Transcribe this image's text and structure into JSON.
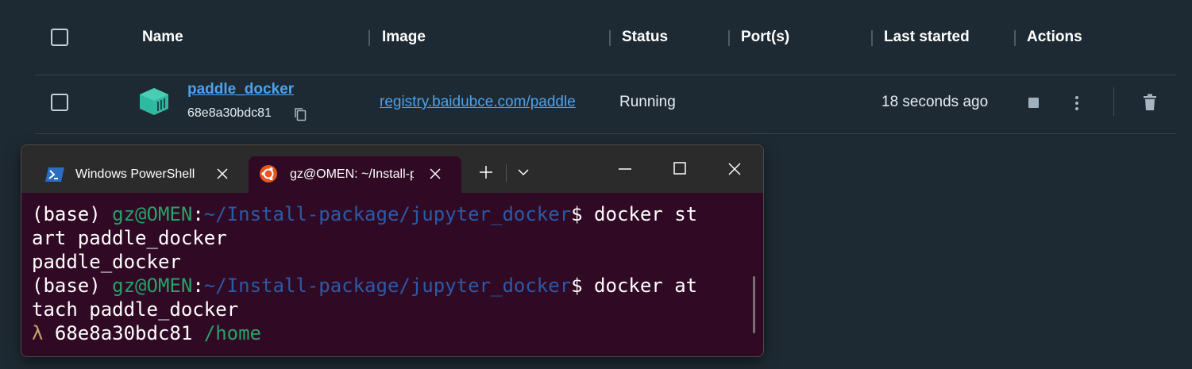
{
  "table": {
    "headers": {
      "name": "Name",
      "image": "Image",
      "status": "Status",
      "ports": "Port(s)",
      "last_started": "Last started",
      "actions": "Actions"
    },
    "rows": [
      {
        "name": "paddle_docker",
        "id": "68e8a30bdc81",
        "image": "registry.baidubce.com/paddle",
        "status": "Running",
        "ports": "",
        "last_started": "18 seconds ago"
      }
    ]
  },
  "terminal": {
    "tabs": [
      {
        "label": "Windows PowerShell",
        "icon": "powershell-icon",
        "active": false
      },
      {
        "label": "gz@OMEN: ~/Install-package/jupyter_docker",
        "icon": "ubuntu-icon",
        "active": true
      }
    ],
    "lines": [
      {
        "prompt_base": "(base) ",
        "prompt_user": "gz@OMEN",
        "prompt_colon": ":",
        "prompt_path": "~/Install-package/jupyter_docker",
        "prompt_dollar": "$",
        "command": " docker st"
      },
      {
        "text": "art paddle_docker"
      },
      {
        "text": "paddle_docker"
      },
      {
        "prompt_base": "(base) ",
        "prompt_user": "gz@OMEN",
        "prompt_colon": ":",
        "prompt_path": "~/Install-package/jupyter_docker",
        "prompt_dollar": "$",
        "command": " docker at"
      },
      {
        "text": "tach paddle_docker"
      },
      {
        "lambda": "λ ",
        "container_id": "68e8a30bdc81 ",
        "cwd": "/home"
      }
    ]
  },
  "colors": {
    "background": "#1e2a33",
    "link": "#4aa3f0",
    "terminal_bg": "#300a24",
    "prompt_user": "#26a269",
    "prompt_path": "#2a5aa8",
    "container_icon": "#2fb9a3"
  }
}
